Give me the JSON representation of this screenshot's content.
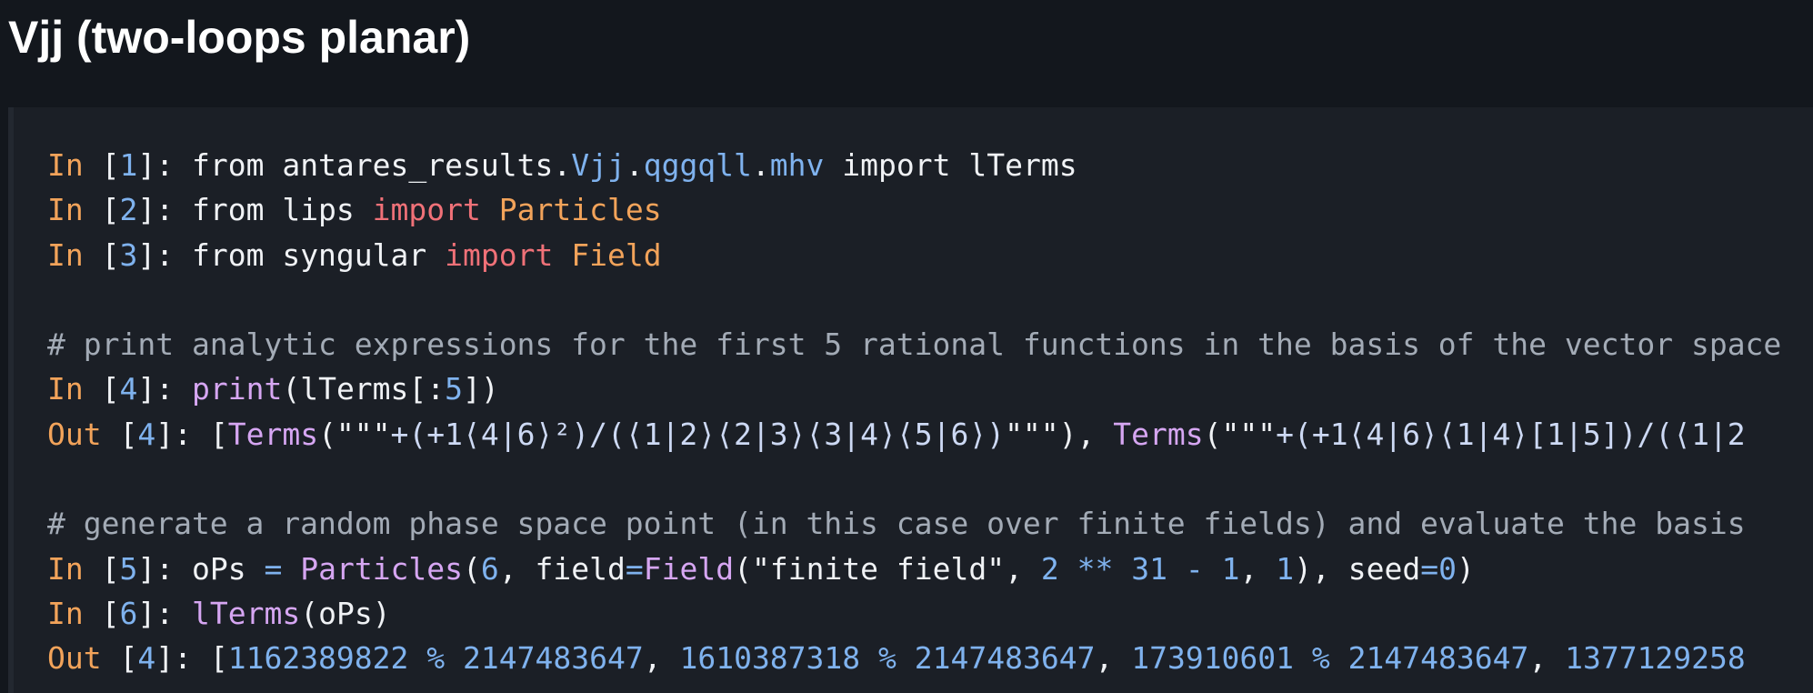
{
  "title": "Vjj (two-loops planar)",
  "colors": {
    "background": "#13171d",
    "code_background": "#1b1f26",
    "prompt": "#f2a35a",
    "number": "#7fb2ee",
    "keyword": "#f07178",
    "function": "#d6a6f2",
    "comment": "#a3abb6",
    "text": "#f0f2f5"
  },
  "cells": {
    "in1": {
      "prompt": "In",
      "num": "1",
      "t1": "from antares_results.",
      "m1": "Vjj",
      "m2": "qggqll",
      "m3": "mhv",
      "t2": "import lTerms"
    },
    "in2": {
      "prompt": "In",
      "num": "2",
      "t1": "from lips",
      "kw": "import",
      "name": "Particles"
    },
    "in3": {
      "prompt": "In",
      "num": "3",
      "t1": "from syngular",
      "kw": "import",
      "name": "Field"
    },
    "comment1": "# print analytic expressions for the first 5 rational functions in the basis of the vector space",
    "in4": {
      "prompt": "In",
      "num": "4",
      "fn": "print",
      "arg": "lTerms[:",
      "n": "5",
      "close": "])"
    },
    "out4": {
      "prompt": "Out",
      "num": "4",
      "fn1": "Terms",
      "str1": "+(+1⟨4|6⟩²)/(⟨1|2⟩⟨2|3⟩⟨3|4⟩⟨5|6⟩)",
      "fn2": "Terms",
      "str2": "+(+1⟨4|6⟩⟨1|4⟩[1|5])/(⟨1|2"
    },
    "comment2": "# generate a random phase space point (in this case over finite fields) and evaluate the basis",
    "in5": {
      "prompt": "In",
      "num": "5",
      "var": "oPs",
      "fn": "Particles",
      "n1": "6",
      "kwarg1": "field",
      "fn2": "Field",
      "str": "\"finite field\"",
      "n2": "2",
      "n3": "31",
      "n4": "1",
      "n5": "1",
      "kwarg2": "seed",
      "n6": "0"
    },
    "in6": {
      "prompt": "In",
      "num": "6",
      "fn": "lTerms",
      "arg": "oPs"
    },
    "out6": {
      "prompt": "Out",
      "num": "4",
      "values": [
        "1162389822",
        "2147483647",
        "1610387318",
        "2147483647",
        "173910601",
        "2147483647",
        "1377129258"
      ]
    }
  }
}
